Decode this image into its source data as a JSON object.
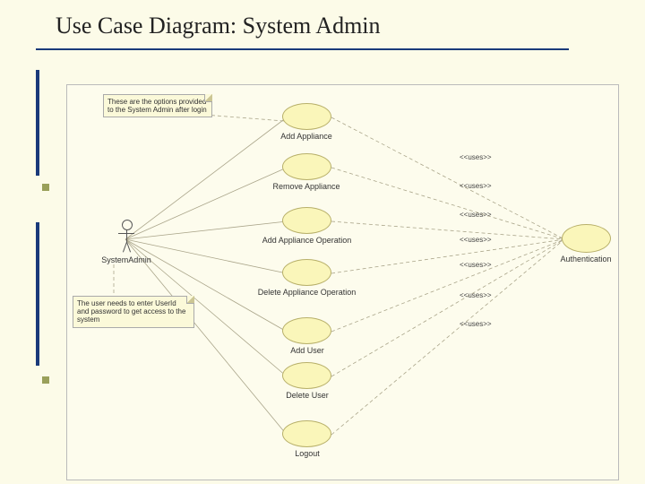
{
  "title": "Use Case Diagram: System Admin",
  "actor": {
    "name": "SystemAdmin"
  },
  "notes": {
    "top": "These are the options provided to the System Admin after login",
    "bottom": "The user needs to enter UserId and password to get access to the system"
  },
  "usecases": {
    "add_appliance": "Add Appliance",
    "remove_appliance": "Remove Appliance",
    "add_op": "Add Appliance Operation",
    "delete_op": "Delete Appliance Operation",
    "add_user": "Add User",
    "delete_user": "Delete User",
    "logout": "Logout",
    "auth": "Authentication"
  },
  "uses_label": "<<uses>>"
}
